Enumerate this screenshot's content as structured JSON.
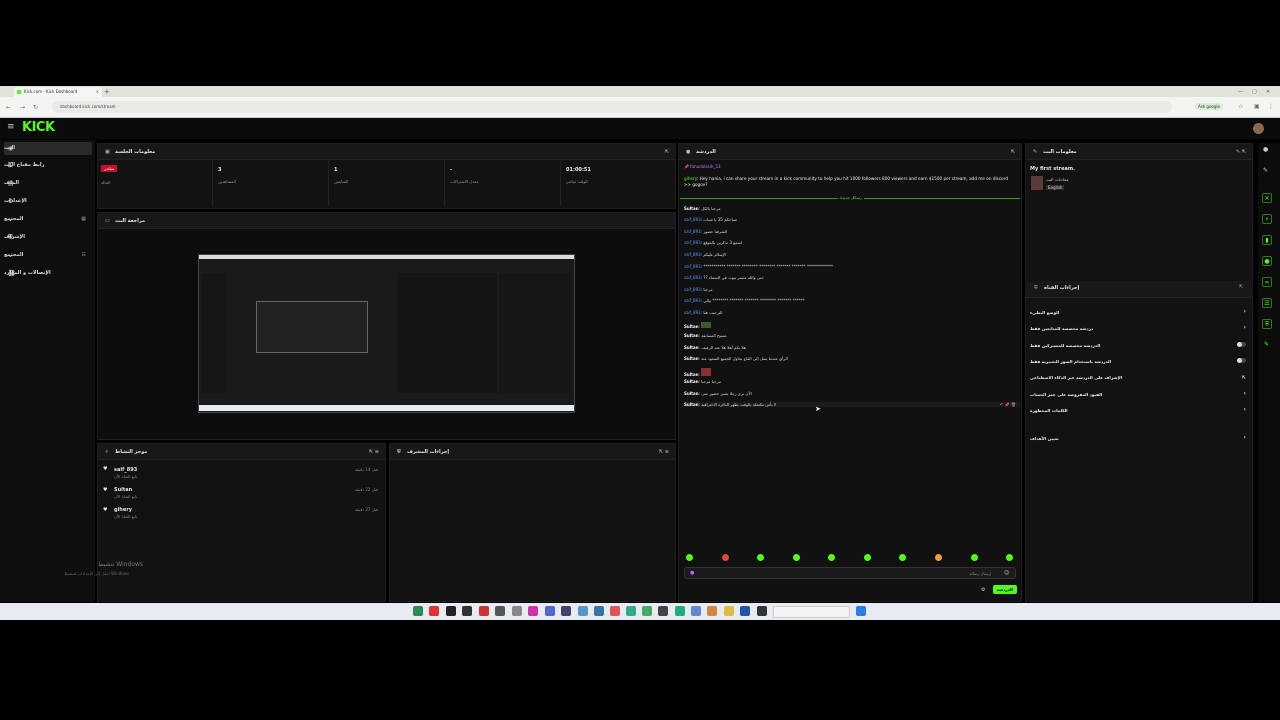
{
  "browser": {
    "tab_title": "Kick.com - Kick Dashboard",
    "new_tab": "+",
    "url": "dashboard.kick.com/stream",
    "add_google": "Ask google",
    "min": "—",
    "max": "▢",
    "close": "✕"
  },
  "app": {
    "logo": "KICK"
  },
  "sidebar": {
    "items": [
      {
        "label": "البث",
        "icon": "broadcast-icon",
        "active": true
      },
      {
        "label": "رابط مفتاح البث",
        "icon": "key-icon"
      },
      {
        "label": "الملف",
        "icon": "file-icon"
      },
      {
        "label": "الإعدادات",
        "icon": "gear-icon"
      },
      {
        "label": "المجتمع",
        "icon": "community-icon"
      },
      {
        "label": "الإشراف",
        "icon": "shield-icon"
      },
      {
        "label": "المجتمع",
        "icon": "people-icon"
      },
      {
        "label": "الإتصالات و الموارد",
        "icon": "link-icon"
      }
    ]
  },
  "session": {
    "title": "معلومات الجلسة",
    "live_badge": "مباشر",
    "live_label": "الحالة",
    "stats": [
      {
        "value": "3",
        "label": "المشاهدين"
      },
      {
        "value": "1",
        "label": "المتابعين"
      },
      {
        "value": "-",
        "label": "معدل الاشتراكات"
      },
      {
        "value": "01:00:51",
        "label": "الوقت مباشر"
      }
    ]
  },
  "preview": {
    "title": "مراجعة البث"
  },
  "activity": {
    "title": "موجز النشاط",
    "items": [
      {
        "name": "saif_893",
        "sub": "تابع القناة الآن",
        "time": "قبل 14 دقيقة"
      },
      {
        "name": "Sultan",
        "sub": "تابع القناة الآن",
        "time": "قبل 22 دقيقة"
      },
      {
        "name": "gihery",
        "sub": "تابع القناة الآن",
        "time": "قبل 27 دقيقة"
      }
    ]
  },
  "mod_actions": {
    "title": "إجراءات المشرف"
  },
  "chat": {
    "title": "الدردشة",
    "pinned_user": "fahadalsaih_53",
    "pinned_by": "gihery",
    "pinned_text": "Hey hania, i can share your stream in a kick community to help you hit 1000 followers 800 viewers and earn $1500 per stream, add me on discord >> gogov?",
    "new_messages": "رسائل جديدة",
    "messages": [
      {
        "user": "Sultan",
        "text": "مرحبا بالكل",
        "white": true
      },
      {
        "user": "saif_893",
        "text": "صباحكم 35 يا شباب"
      },
      {
        "user": "saif_893",
        "text": "الشرفنا حضور"
      },
      {
        "user": "saif_893",
        "text": "اسمع 3 تذكرين بالموقع"
      },
      {
        "user": "saif_893",
        "text": "الإسلام عليكم"
      },
      {
        "user": "saif_893",
        "text": "*********** ******* ******** ******** ******* ******* *************"
      },
      {
        "user": "saif_893",
        "text": "?? حتى والله مستر بيوت في السماء"
      },
      {
        "user": "saif_893",
        "text": "مرحبا"
      },
      {
        "user": "saif_893",
        "text": "والي ******** ******* ******* ******** ******* ******"
      },
      {
        "user": "saif_893",
        "text": "الترحيب هنا"
      },
      {
        "user": "Sultan",
        "text": "",
        "white": true
      },
      {
        "user": "Sultan",
        "text": "مسيح المسابقة",
        "white": true
      },
      {
        "user": "Sultan",
        "text": "هلا بكم أهلا هلا عند الرغيف",
        "white": true
      },
      {
        "user": "Sultan",
        "text": "الرأي عندما يصل إلى القاع يحاول الجميع الصعود منه",
        "white": true
      },
      {
        "user": "Sultan",
        "text": "",
        "white": true
      },
      {
        "user": "Sultan",
        "text": "مرحبا مرحبا",
        "white": true
      },
      {
        "user": "Sultan",
        "text": "الآن نرى رجلا يصير حضور متى",
        "white": true
      },
      {
        "user": "Sultan",
        "text": "لا بأس مكتملة بالوقت يظهر الدائرة الاحترافية",
        "white": true
      }
    ],
    "input_placeholder": "إرسال رسالة",
    "send": "الدردشة"
  },
  "stream_info": {
    "title": "معلومات البث",
    "stream_title": "My first stream.",
    "category": "محادثات البث",
    "language": "English"
  },
  "channel_actions": {
    "title": "إجراءات القناة",
    "items": [
      {
        "label": "الوضع البطيء",
        "type": "chevron"
      },
      {
        "label": "دردشة مخصصة للمتابعين فقط",
        "type": "chevron"
      },
      {
        "label": "الدردشة مخصصة للمشتركين فقط",
        "type": "toggle"
      },
      {
        "label": "الدردشة باستخدام الصور التعبيرية فقط",
        "type": "toggle"
      },
      {
        "label": "الإشراف على الدردشة عبر الذكاء الاصطناعي",
        "type": "external"
      },
      {
        "label": "القيود المفروضة على عمر الحساب",
        "type": "chevron"
      },
      {
        "label": "الكلمات المحظورة",
        "type": "chevron"
      },
      {
        "label": "تعيين الأهداف",
        "type": "chevron"
      }
    ]
  },
  "windows": {
    "activate": "تنشيط Windows",
    "activate_sub": "انتقل إلى الإعدادات لتنشيط Windows"
  }
}
